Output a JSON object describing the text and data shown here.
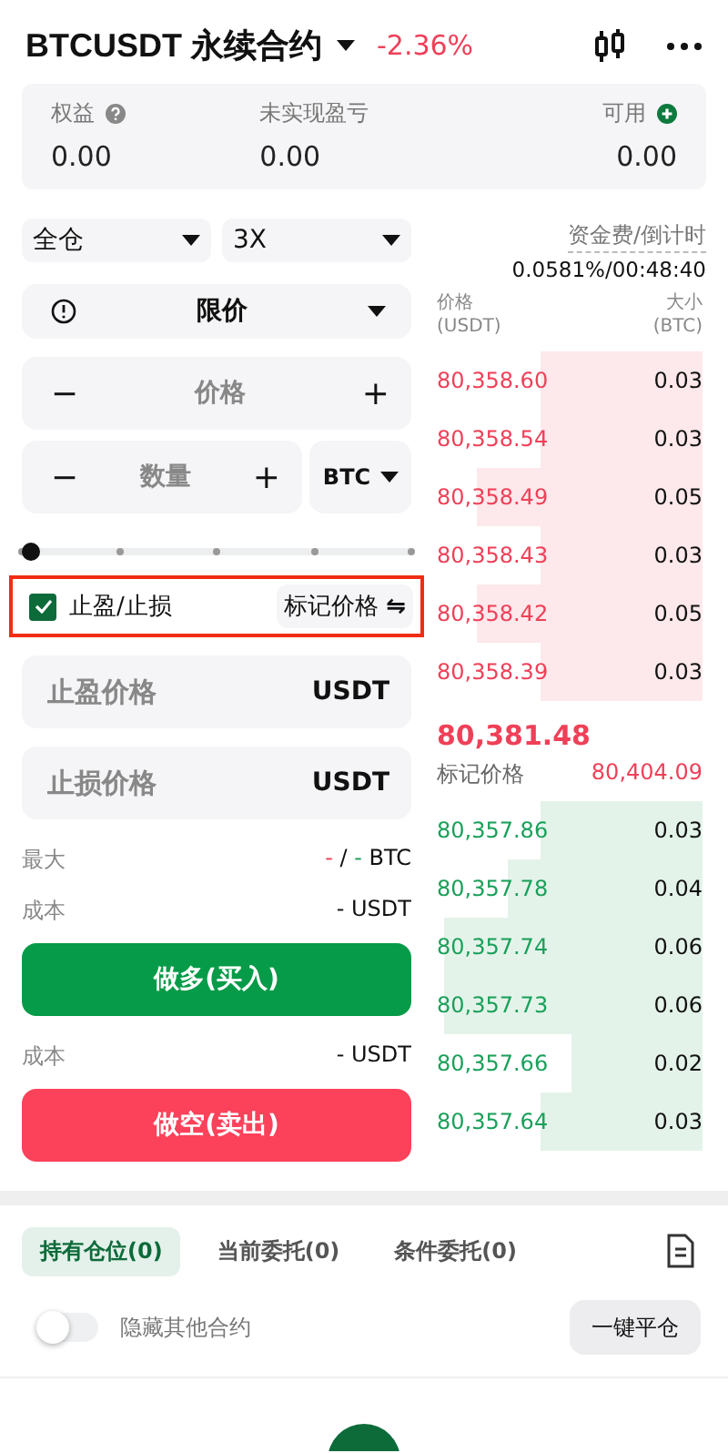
{
  "header": {
    "symbol": "BTCUSDT 永续合约",
    "change": "-2.36%"
  },
  "account": [
    {
      "label": "权益",
      "value": "0.00"
    },
    {
      "label": "未实现盈亏",
      "value": "0.00"
    },
    {
      "label": "可用",
      "value": "0.00"
    }
  ],
  "margin_mode": "全仓",
  "leverage": "3X",
  "funding": {
    "label": "资金费/倒计时",
    "value": "0.0581%/00:48:40"
  },
  "order_type": "限价",
  "price_field": {
    "minus": "−",
    "placeholder": "价格",
    "plus": "+"
  },
  "qty_field": {
    "minus": "−",
    "placeholder": "数量",
    "plus": "+",
    "unit": "BTC"
  },
  "slider": {
    "level": 0
  },
  "tpsl": {
    "label": "止盈/止损",
    "checked": true,
    "trigger": "标记价格",
    "trigger_icon": "⇋"
  },
  "tp_field": {
    "placeholder": "止盈价格",
    "unit": "USDT"
  },
  "sl_field": {
    "placeholder": "止损价格",
    "unit": "USDT"
  },
  "max": {
    "label": "最大",
    "value_red": "-",
    "sep": "/",
    "value_green": "-",
    "unit": "BTC"
  },
  "buy": {
    "cost_label": "成本",
    "cost": "- USDT",
    "button": "做多(买入)"
  },
  "sell": {
    "cost_label": "成本",
    "cost": "- USDT",
    "button": "做空(卖出)"
  },
  "book": {
    "price_head": "价格",
    "price_unit": "(USDT)",
    "size_head": "大小",
    "size_unit": "(BTC)",
    "asks": [
      {
        "price": "80,358.60",
        "size": "0.03"
      },
      {
        "price": "80,358.54",
        "size": "0.03"
      },
      {
        "price": "80,358.49",
        "size": "0.05"
      },
      {
        "price": "80,358.43",
        "size": "0.03"
      },
      {
        "price": "80,358.42",
        "size": "0.05"
      },
      {
        "price": "80,358.39",
        "size": "0.03"
      }
    ],
    "last_price": "80,381.48",
    "mark_label": "标记价格",
    "mark_price": "80,404.09",
    "bids": [
      {
        "price": "80,357.86",
        "size": "0.03"
      },
      {
        "price": "80,357.78",
        "size": "0.04"
      },
      {
        "price": "80,357.74",
        "size": "0.06"
      },
      {
        "price": "80,357.73",
        "size": "0.06"
      },
      {
        "price": "80,357.66",
        "size": "0.02"
      },
      {
        "price": "80,357.64",
        "size": "0.03"
      }
    ]
  },
  "tabs": [
    {
      "label": "持有仓位(0)",
      "selected": true
    },
    {
      "label": "当前委托(0)",
      "selected": false
    },
    {
      "label": "条件委托(0)",
      "selected": false
    }
  ],
  "hide_others": {
    "label": "隐藏其他合约",
    "on": false
  },
  "close_all": "一键平仓"
}
